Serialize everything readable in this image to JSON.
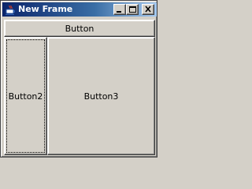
{
  "window": {
    "title": "New Frame",
    "icon": "java-cup-icon",
    "controls": {
      "minimize_icon": "minimize-icon",
      "maximize_icon": "maximize-icon",
      "close_icon": "close-icon"
    }
  },
  "content": {
    "top_button_label": "Button",
    "left_button_label": "Button2",
    "center_button_label": "Button3",
    "focused_button": "Button2"
  },
  "colors": {
    "title_start": "#0a246a",
    "title_end": "#a6caf0",
    "face": "#d4d0c8"
  }
}
